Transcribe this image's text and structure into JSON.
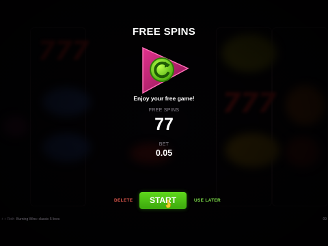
{
  "popup": {
    "title": "FREE SPINS",
    "subtitle": "Enjoy your free game!",
    "free_spins_label": "FREE SPINS",
    "free_spins_value": "77",
    "bet_label": "BET",
    "bet_value": "0.05"
  },
  "actions": {
    "delete_label": "DELETE",
    "start_label": "START",
    "use_later_label": "USE LATER"
  },
  "footer": {
    "left_text": "+ + Roth",
    "game_name": "Burning Wins: classic 5 lines",
    "right_text": "09"
  },
  "background": {
    "symbols": [
      "777",
      "777"
    ]
  },
  "colors": {
    "start_button": "#4cc414",
    "delete_text": "#e0574c",
    "use_later_text": "#7fe04a",
    "logo_magenta": "#c0267a",
    "logo_green": "#6ed81e"
  },
  "icons": {
    "logo": "play-replay-logo-icon",
    "pointer": "hand-pointer-icon"
  }
}
